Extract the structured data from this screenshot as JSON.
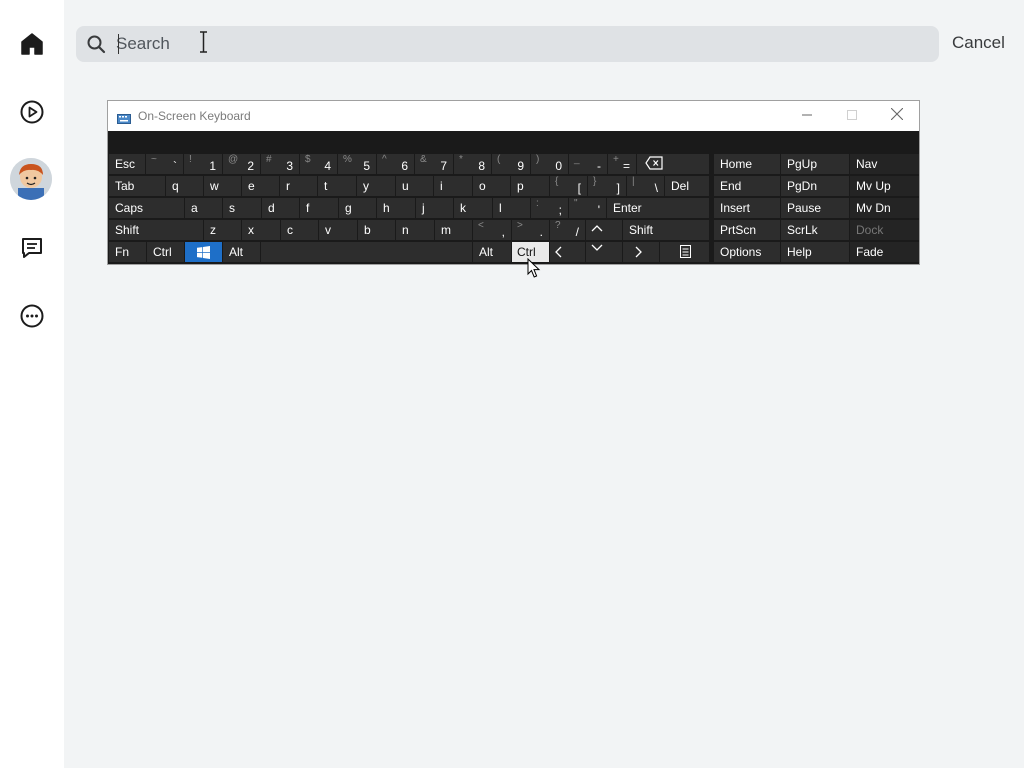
{
  "sidebar": {
    "items": [
      {
        "name": "home-icon"
      },
      {
        "name": "play-icon"
      },
      {
        "name": "avatar"
      },
      {
        "name": "chat-icon"
      },
      {
        "name": "more-icon"
      }
    ]
  },
  "search": {
    "placeholder": "Search",
    "cancel_label": "Cancel"
  },
  "osk": {
    "title": "On-Screen Keyboard",
    "rows": [
      [
        {
          "label": "Esc"
        },
        {
          "shift": "~",
          "main": "`"
        },
        {
          "shift": "!",
          "main": "1"
        },
        {
          "shift": "@",
          "main": "2"
        },
        {
          "shift": "#",
          "main": "3"
        },
        {
          "shift": "$",
          "main": "4"
        },
        {
          "shift": "%",
          "main": "5"
        },
        {
          "shift": "^",
          "main": "6"
        },
        {
          "shift": "&",
          "main": "7"
        },
        {
          "shift": "*",
          "main": "8"
        },
        {
          "shift": "(",
          "main": "9"
        },
        {
          "shift": ")",
          "main": "0"
        },
        {
          "shift": "_",
          "main": "-"
        },
        {
          "shift": "+",
          "main": "="
        },
        {
          "label": "⌫"
        }
      ],
      [
        {
          "label": "Tab"
        },
        {
          "label": "q"
        },
        {
          "label": "w"
        },
        {
          "label": "e"
        },
        {
          "label": "r"
        },
        {
          "label": "t"
        },
        {
          "label": "y"
        },
        {
          "label": "u"
        },
        {
          "label": "i"
        },
        {
          "label": "o"
        },
        {
          "label": "p"
        },
        {
          "shift": "{",
          "main": "["
        },
        {
          "shift": "}",
          "main": "]"
        },
        {
          "shift": "|",
          "main": "\\"
        },
        {
          "label": "Del"
        }
      ],
      [
        {
          "label": "Caps"
        },
        {
          "label": "a"
        },
        {
          "label": "s"
        },
        {
          "label": "d"
        },
        {
          "label": "f"
        },
        {
          "label": "g"
        },
        {
          "label": "h"
        },
        {
          "label": "j"
        },
        {
          "label": "k"
        },
        {
          "label": "l"
        },
        {
          "shift": ":",
          "main": ";"
        },
        {
          "shift": "\"",
          "main": "'"
        },
        {
          "label": "Enter"
        }
      ],
      [
        {
          "label": "Shift"
        },
        {
          "label": "z"
        },
        {
          "label": "x"
        },
        {
          "label": "c"
        },
        {
          "label": "v"
        },
        {
          "label": "b"
        },
        {
          "label": "n"
        },
        {
          "label": "m"
        },
        {
          "shift": "<",
          "main": ","
        },
        {
          "shift": ">",
          "main": "."
        },
        {
          "shift": "?",
          "main": "/"
        },
        {
          "label": "^"
        },
        {
          "label": "Shift"
        }
      ],
      [
        {
          "label": "Fn"
        },
        {
          "label": "Ctrl"
        },
        {
          "label": "win"
        },
        {
          "label": "Alt"
        },
        {
          "label": ""
        },
        {
          "label": "Alt"
        },
        {
          "label": "Ctrl"
        },
        {
          "label": "<"
        },
        {
          "label": "v"
        },
        {
          "label": ">"
        },
        {
          "label": "menu"
        }
      ]
    ],
    "nav_rows": [
      [
        "Home",
        "PgUp",
        "Nav"
      ],
      [
        "End",
        "PgDn",
        "Mv Up"
      ],
      [
        "Insert",
        "Pause",
        "Mv Dn"
      ],
      [
        "PrtScn",
        "ScrLk",
        "Dock"
      ],
      [
        "Options",
        "Help",
        "Fade"
      ]
    ]
  },
  "colors": {
    "background": "#f2f4f5",
    "search_bg": "#dfe2e5",
    "key_bg": "#2d2d2d",
    "win_key": "#1e6fc8",
    "pressed_key": "#e9e9e9"
  }
}
